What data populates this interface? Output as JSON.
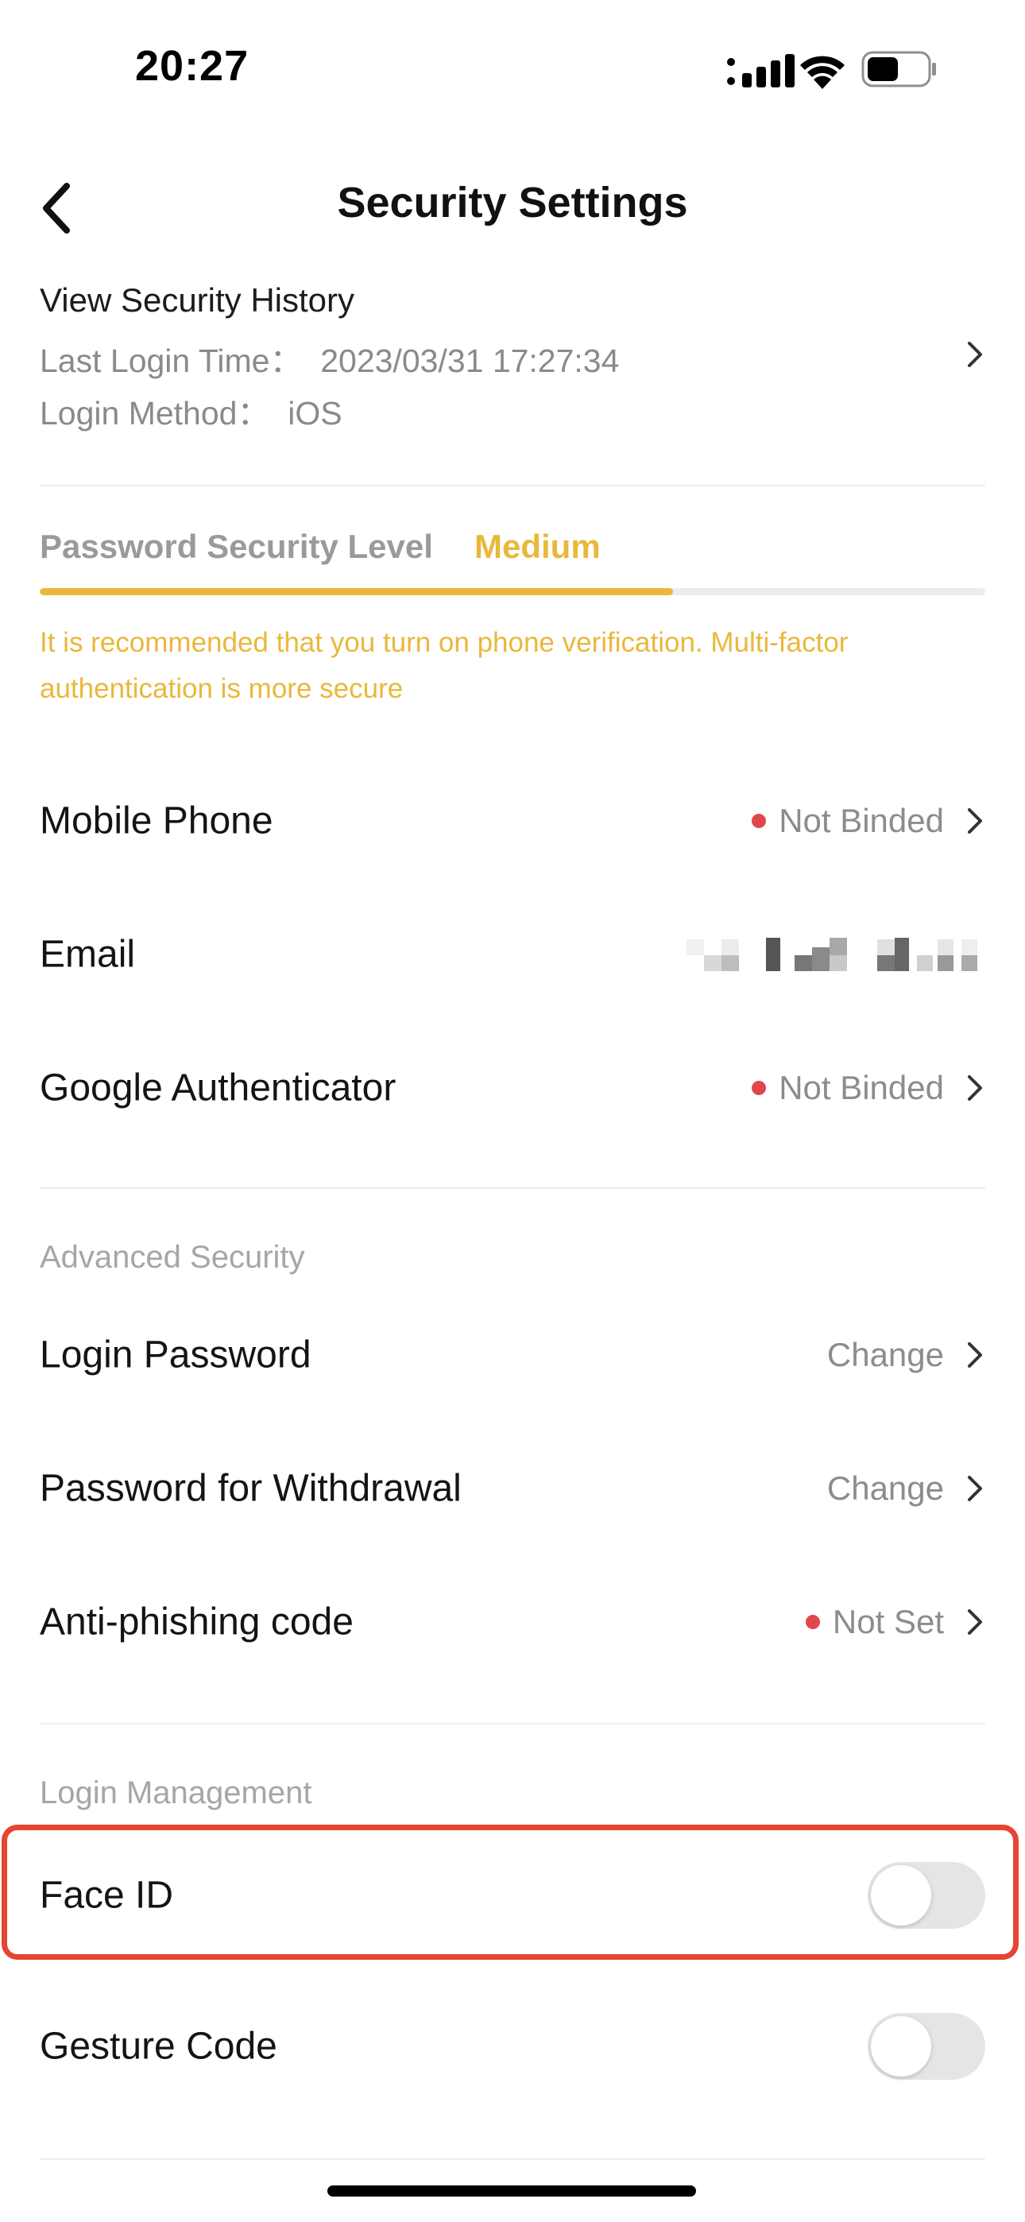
{
  "status_bar": {
    "time": "20:27"
  },
  "header": {
    "title": "Security Settings"
  },
  "security_history": {
    "title": "View Security History",
    "last_login": "Last Login Time：  2023/03/31 17:27:34",
    "login_method": "Login Method：  iOS"
  },
  "password_level": {
    "label": "Password Security Level",
    "value": "Medium",
    "progress": 0.67,
    "recommendation": "It is recommended that you turn on phone verification. Multi-factor authentication is more secure"
  },
  "rows": {
    "mobile_phone": {
      "label": "Mobile Phone",
      "status": "Not Binded"
    },
    "email": {
      "label": "Email"
    },
    "google_auth": {
      "label": "Google Authenticator",
      "status": "Not Binded"
    }
  },
  "advanced_security": {
    "title": "Advanced Security",
    "login_password": {
      "label": "Login Password",
      "action": "Change"
    },
    "withdrawal_password": {
      "label": "Password for Withdrawal",
      "action": "Change"
    },
    "anti_phishing": {
      "label": "Anti-phishing code",
      "status": "Not Set"
    }
  },
  "login_management": {
    "title": "Login Management",
    "face_id": {
      "label": "Face ID",
      "enabled": false
    },
    "gesture_code": {
      "label": "Gesture Code",
      "enabled": false
    }
  },
  "colors": {
    "accent": "#e9b83b",
    "alert_dot": "#e0474c",
    "highlight": "#e54532",
    "toggle_off": "#e5e5e5"
  },
  "icons": [
    "signal-icon",
    "wifi-icon",
    "battery-icon",
    "back-arrow-icon",
    "chevron-right-icon"
  ]
}
